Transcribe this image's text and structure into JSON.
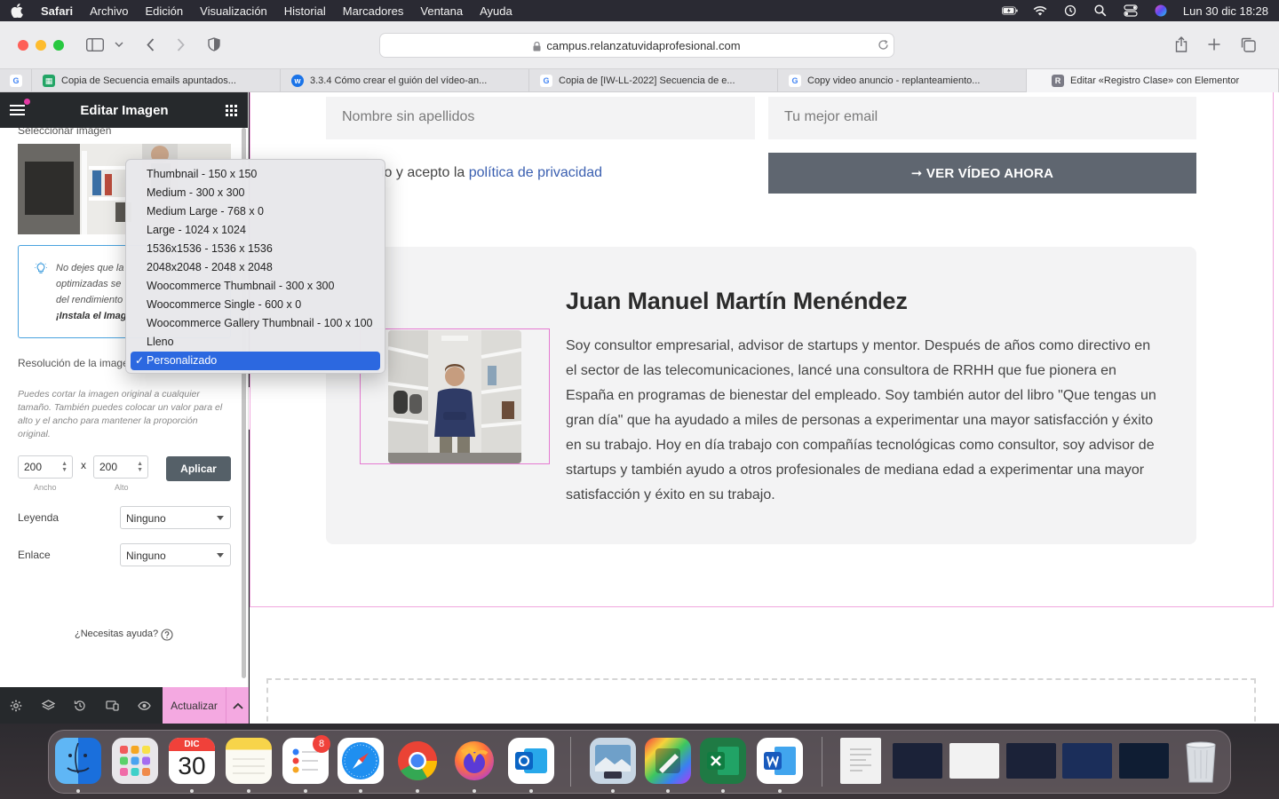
{
  "menubar": {
    "app": "Safari",
    "items": [
      "Archivo",
      "Edición",
      "Visualización",
      "Historial",
      "Marcadores",
      "Ventana",
      "Ayuda"
    ],
    "clock": "Lun 30 dic  18:28"
  },
  "browser": {
    "url": "campus.relanzatuvidaprofesional.com",
    "tabs": [
      {
        "label": "Copia de Secuencia emails apuntados...",
        "icon": "sheets-icon"
      },
      {
        "label": "3.3.4 Cómo crear el guión del vídeo-an...",
        "icon": "wix-icon"
      },
      {
        "label": "Copia de [IW-LL-2022] Secuencia de e...",
        "icon": "google-icon"
      },
      {
        "label": "Copy video anuncio - replanteamiento...",
        "icon": "google-icon"
      },
      {
        "label": "Editar «Registro Clase» con Elementor",
        "icon": "r-icon",
        "fav_letter": "R"
      }
    ]
  },
  "panel": {
    "title": "Editar Imagen",
    "select_image_label": "Seleccionar imagen",
    "info_text_lines": [
      "No dejes que la",
      "optimizadas se",
      "del rendimiento",
      "¡Instala el Imag"
    ],
    "resolution_label": "Resolución de la imagen",
    "help_text": "Puedes cortar la imagen original a cualquier tamaño. También puedes colocar un valor para el alto y el ancho para mantener la proporción original.",
    "width_value": "200",
    "height_value": "200",
    "times": "x",
    "width_label": "Ancho",
    "height_label": "Alto",
    "apply_label": "Aplicar",
    "caption_label": "Leyenda",
    "caption_value": "Ninguno",
    "link_label": "Enlace",
    "link_value": "Ninguno",
    "help_link": "¿Necesitas ayuda?",
    "update_label": "Actualizar"
  },
  "dropdown": {
    "options": [
      "Thumbnail - 150 x 150",
      "Medium - 300 x 300",
      "Medium Large - 768 x 0",
      "Large - 1024 x 1024",
      "1536x1536 - 1536 x 1536",
      "2048x2048 - 2048 x 2048",
      "Woocommerce Thumbnail - 300 x 300",
      "Woocommerce Single - 600 x 0",
      "Woocommerce Gallery Thumbnail - 100 x 100",
      "Lleno",
      "Personalizado"
    ],
    "selected": "Personalizado",
    "check": "✓"
  },
  "page": {
    "name_placeholder": "Nombre sin apellidos",
    "email_placeholder": "Tu mejor email",
    "consent_prefix": "lo y acepto la ",
    "consent_link": "política de privacidad",
    "video_button": "➞ VER VÍDEO AHORA",
    "bio_name": "Juan Manuel Martín Menéndez",
    "bio_text": "Soy consultor empresarial, advisor de startups y mentor. Después de años como directivo en el sector de las telecomunicaciones, lancé una consultora de RRHH que fue pionera en España en programas de bienestar del empleado. Soy también autor del libro \"Que tengas un gran día\" que ha ayudado a miles de personas a experimentar una mayor satisfacción y éxito en su trabajo. Hoy en día trabajo con compañías tecnológicas como consultor, soy advisor de startups y también ayudo a otros profesionales de mediana edad a experimentar una mayor satisfacción y éxito en su trabajo."
  },
  "dock": {
    "calendar_month": "DIC",
    "calendar_day": "30",
    "reminders_badge": "8"
  },
  "colors": {
    "elementor_dark": "#26292c",
    "elementor_pink": "#f4a9e1",
    "select_blue": "#2c68e0",
    "video_button": "#5f6670"
  }
}
